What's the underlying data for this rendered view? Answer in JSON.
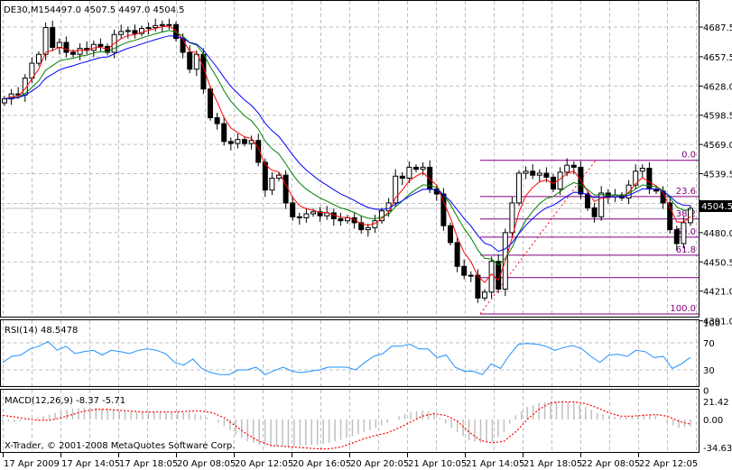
{
  "header": {
    "symbol": "DE30,M15",
    "ohlc": "4497.0 4507.5 4497.0 4504.5"
  },
  "current_price": "4504.5",
  "copyright": "X-Trader, © 2001-2008 MetaQuotes Software Corp.",
  "colors": {
    "ma_fast": "#ff0000",
    "ma_mid": "#008000",
    "ma_slow": "#0000ff",
    "fib": "#800080",
    "rsi": "#1e90ff",
    "macd_hist": "#c0c0c0",
    "macd_signal": "#ff0000"
  },
  "chart_data": [
    {
      "type": "candlestick",
      "title": "DE30,M15",
      "ylim": [
        4391.0,
        4687.5
      ],
      "y_ticks": [
        "4687.5",
        "4657.5",
        "4628.0",
        "4598.5",
        "4569.0",
        "4539.5",
        "4509.5",
        "4480.0",
        "4450.5",
        "4421.0",
        "4391.0"
      ],
      "x_ticks": [
        "17 Apr 2009",
        "17 Apr 14:05",
        "17 Apr 18:05",
        "20 Apr 08:05",
        "20 Apr 12:05",
        "20 Apr 16:05",
        "20 Apr 20:05",
        "21 Apr 10:05",
        "21 Apr 14:05",
        "21 Apr 18:05",
        "22 Apr 08:05",
        "22 Apr 12:05"
      ],
      "closes": [
        4615,
        4620,
        4619,
        4636,
        4651,
        4660,
        4687,
        4667,
        4672,
        4662,
        4660,
        4666,
        4664,
        4670,
        4668,
        4662,
        4680,
        4683,
        4684,
        4681,
        4686,
        4687,
        4689,
        4690,
        4690,
        4676,
        4662,
        4645,
        4660,
        4625,
        4596,
        4590,
        4572,
        4570,
        4574,
        4570,
        4573,
        4551,
        4523,
        4535,
        4538,
        4510,
        4496,
        4495,
        4499,
        4501,
        4497,
        4500,
        4494,
        4492,
        4495,
        4490,
        4483,
        4485,
        4492,
        4502,
        4510,
        4537,
        4535,
        4546,
        4544,
        4546,
        4524,
        4519,
        4487,
        4470,
        4446,
        4437,
        4437,
        4414,
        4420,
        4451,
        4423,
        4480,
        4510,
        4540,
        4542,
        4538,
        4540,
        4536,
        4524,
        4541,
        4548,
        4546,
        4519,
        4505,
        4496,
        4520,
        4516,
        4518,
        4515,
        4528,
        4542,
        4545,
        4524,
        4522,
        4510,
        4483,
        4469,
        4490,
        4504.5
      ],
      "fibonacci": {
        "high": 4553,
        "low": 4398,
        "levels": [
          {
            "value": 0.0,
            "label": "0.0"
          },
          {
            "value": 23.6,
            "label": "23.6"
          },
          {
            "value": 38.2,
            "label": "38.2"
          },
          {
            "value": 50.0,
            "label": "50.0"
          },
          {
            "value": 61.8,
            "label": "61.8"
          },
          {
            "value": 76.4,
            "label": ""
          },
          {
            "value": 100.0,
            "label": "100.0"
          }
        ]
      }
    },
    {
      "type": "line",
      "title": "RSI(14) 48.5478",
      "ylim": [
        0,
        100
      ],
      "y_ticks": [
        "100",
        "70",
        "30",
        "0"
      ],
      "values": [
        41,
        50,
        52,
        61,
        65,
        72,
        59,
        65,
        54,
        57,
        59,
        52,
        59,
        57,
        54,
        59,
        61,
        59,
        54,
        41,
        37,
        46,
        32,
        26,
        23,
        23,
        30,
        30,
        34,
        23,
        29,
        34,
        28,
        26,
        28,
        30,
        34,
        34,
        34,
        30,
        41,
        50,
        54,
        65,
        65,
        68,
        61,
        61,
        48,
        52,
        34,
        28,
        28,
        23,
        39,
        32,
        52,
        68,
        69,
        68,
        65,
        59,
        63,
        66,
        61,
        50,
        41,
        52,
        53,
        50,
        59,
        57,
        48,
        50,
        32,
        39,
        48.5
      ]
    },
    {
      "type": "bar",
      "title": "MACD(12,26,9) -8.37 -5.71",
      "ylim": [
        -34.63,
        21.42
      ],
      "y_ticks": [
        "21.42",
        "0.00",
        "-34.63"
      ],
      "histogram": [
        -2,
        -3,
        -1,
        2,
        6,
        10,
        13,
        14,
        14,
        13,
        10,
        9,
        9,
        9,
        9,
        9,
        8,
        5,
        0,
        -8,
        -18,
        -26,
        -30,
        -32,
        -32,
        -32,
        -31,
        -30,
        -28,
        -24,
        -20,
        -15,
        -10,
        -4,
        4,
        9,
        11,
        8,
        -5,
        -15,
        -25,
        -28,
        -27,
        -15,
        5,
        15,
        20,
        21,
        21,
        20,
        15,
        8,
        4,
        3,
        4,
        6,
        5,
        -4,
        -10,
        -8.37
      ],
      "signal": [
        5,
        3,
        1,
        -1,
        -1,
        2,
        6,
        10,
        12,
        12,
        11,
        10,
        9,
        9,
        9,
        9,
        10,
        10,
        8,
        2,
        -8,
        -18,
        -26,
        -31,
        -32,
        -33,
        -34,
        -35,
        -35,
        -33,
        -28,
        -23,
        -19,
        -16,
        -10,
        -3,
        4,
        7,
        5,
        -2,
        -15,
        -25,
        -28,
        -26,
        -15,
        0,
        12,
        20,
        21,
        21,
        19,
        14,
        8,
        4,
        4,
        5,
        6,
        4,
        -2,
        -5.71
      ]
    }
  ]
}
